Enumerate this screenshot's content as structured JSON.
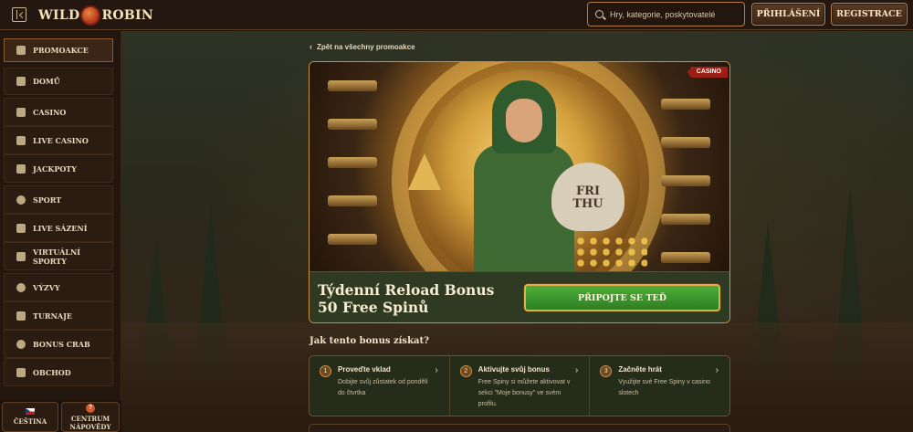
{
  "header": {
    "logo_left": "WILD",
    "logo_right": "ROBIN",
    "search_placeholder": "Hry, kategorie, poskytovatelé",
    "login_label": "PŘIHLÁŠENÍ",
    "register_label": "REGISTRACE"
  },
  "sidebar": {
    "items": [
      {
        "label": "PROMOAKCE",
        "icon": "gift-icon",
        "active": true
      },
      {
        "label": "DOMŮ",
        "icon": "home-icon"
      },
      {
        "label": "CASINO",
        "icon": "slot-machine-icon"
      },
      {
        "label": "LIVE CASINO",
        "icon": "cards-icon"
      },
      {
        "label": "JACKPOTY",
        "icon": "jackpot-icon"
      },
      {
        "label": "SPORT",
        "icon": "ball-icon"
      },
      {
        "label": "LIVE SÁZENÍ",
        "icon": "live-icon"
      },
      {
        "label": "VIRTUÁLNÍ SPORTY",
        "icon": "virtual-sports-icon"
      },
      {
        "label": "VÝZVY",
        "icon": "target-icon"
      },
      {
        "label": "TURNAJE",
        "icon": "trophy-icon"
      },
      {
        "label": "BONUS CRAB",
        "icon": "crab-icon"
      },
      {
        "label": "OBCHOD",
        "icon": "shop-icon"
      }
    ],
    "footer": {
      "language_label": "ČEŠTINA",
      "help_label_1": "CENTRUM",
      "help_label_2": "NÁPOVĚDY"
    }
  },
  "main": {
    "back_link": "Zpět na všechny promoakce",
    "badge": "CASINO",
    "sack_text_1": "FRI",
    "sack_text_2": "THU",
    "promo_title": "Týdenní Reload Bonus 50 Free Spinů",
    "join_label": "PŘIPOJTE SE TEĎ",
    "how_title": "Jak tento bonus získat?",
    "steps": [
      {
        "num": "1",
        "title": "Proveďte vklad",
        "desc": "Dobijte svůj zůstatek od pondělí do čtvrtka"
      },
      {
        "num": "2",
        "title": "Aktivujte svůj bonus",
        "desc": "Free Spiny si můžete aktivovat v sekci \"Moje bonusy\" ve svém profilu."
      },
      {
        "num": "3",
        "title": "Začněte hrát",
        "desc": "Využijte své Free Spiny v casino slotech"
      }
    ]
  }
}
